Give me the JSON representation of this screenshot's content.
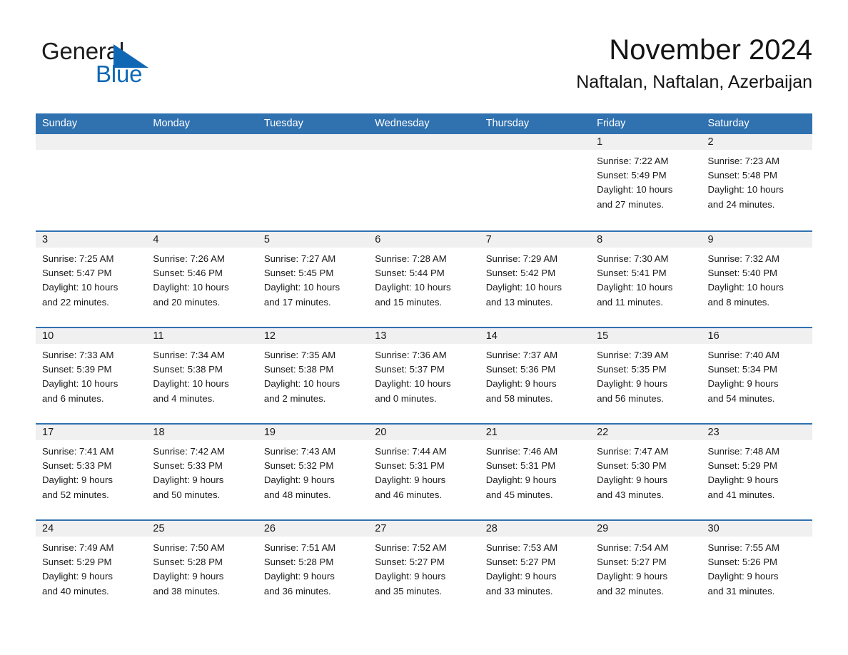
{
  "brand": {
    "word1": "General",
    "word2": "Blue",
    "triangle_color": "#1068b5"
  },
  "header": {
    "title": "November 2024",
    "subtitle": "Naftalan, Naftalan, Azerbaijan"
  },
  "colors": {
    "header_blue": "#3071b0",
    "day_head_grey": "#f0f0f0",
    "text": "#1a1a1a",
    "brand_blue": "#1068b5"
  },
  "weekday_headers": [
    "Sunday",
    "Monday",
    "Tuesday",
    "Wednesday",
    "Thursday",
    "Friday",
    "Saturday"
  ],
  "labels": {
    "sunrise_prefix": "Sunrise: ",
    "sunset_prefix": "Sunset: ",
    "daylight_prefix": "Daylight: "
  },
  "weeks": [
    [
      {
        "day": "",
        "empty": true
      },
      {
        "day": "",
        "empty": true
      },
      {
        "day": "",
        "empty": true
      },
      {
        "day": "",
        "empty": true
      },
      {
        "day": "",
        "empty": true
      },
      {
        "day": "1",
        "sunrise": "Sunrise: 7:22 AM",
        "sunset": "Sunset: 5:49 PM",
        "daylight1": "Daylight: 10 hours",
        "daylight2": "and 27 minutes."
      },
      {
        "day": "2",
        "sunrise": "Sunrise: 7:23 AM",
        "sunset": "Sunset: 5:48 PM",
        "daylight1": "Daylight: 10 hours",
        "daylight2": "and 24 minutes."
      }
    ],
    [
      {
        "day": "3",
        "sunrise": "Sunrise: 7:25 AM",
        "sunset": "Sunset: 5:47 PM",
        "daylight1": "Daylight: 10 hours",
        "daylight2": "and 22 minutes."
      },
      {
        "day": "4",
        "sunrise": "Sunrise: 7:26 AM",
        "sunset": "Sunset: 5:46 PM",
        "daylight1": "Daylight: 10 hours",
        "daylight2": "and 20 minutes."
      },
      {
        "day": "5",
        "sunrise": "Sunrise: 7:27 AM",
        "sunset": "Sunset: 5:45 PM",
        "daylight1": "Daylight: 10 hours",
        "daylight2": "and 17 minutes."
      },
      {
        "day": "6",
        "sunrise": "Sunrise: 7:28 AM",
        "sunset": "Sunset: 5:44 PM",
        "daylight1": "Daylight: 10 hours",
        "daylight2": "and 15 minutes."
      },
      {
        "day": "7",
        "sunrise": "Sunrise: 7:29 AM",
        "sunset": "Sunset: 5:42 PM",
        "daylight1": "Daylight: 10 hours",
        "daylight2": "and 13 minutes."
      },
      {
        "day": "8",
        "sunrise": "Sunrise: 7:30 AM",
        "sunset": "Sunset: 5:41 PM",
        "daylight1": "Daylight: 10 hours",
        "daylight2": "and 11 minutes."
      },
      {
        "day": "9",
        "sunrise": "Sunrise: 7:32 AM",
        "sunset": "Sunset: 5:40 PM",
        "daylight1": "Daylight: 10 hours",
        "daylight2": "and 8 minutes."
      }
    ],
    [
      {
        "day": "10",
        "sunrise": "Sunrise: 7:33 AM",
        "sunset": "Sunset: 5:39 PM",
        "daylight1": "Daylight: 10 hours",
        "daylight2": "and 6 minutes."
      },
      {
        "day": "11",
        "sunrise": "Sunrise: 7:34 AM",
        "sunset": "Sunset: 5:38 PM",
        "daylight1": "Daylight: 10 hours",
        "daylight2": "and 4 minutes."
      },
      {
        "day": "12",
        "sunrise": "Sunrise: 7:35 AM",
        "sunset": "Sunset: 5:38 PM",
        "daylight1": "Daylight: 10 hours",
        "daylight2": "and 2 minutes."
      },
      {
        "day": "13",
        "sunrise": "Sunrise: 7:36 AM",
        "sunset": "Sunset: 5:37 PM",
        "daylight1": "Daylight: 10 hours",
        "daylight2": "and 0 minutes."
      },
      {
        "day": "14",
        "sunrise": "Sunrise: 7:37 AM",
        "sunset": "Sunset: 5:36 PM",
        "daylight1": "Daylight: 9 hours",
        "daylight2": "and 58 minutes."
      },
      {
        "day": "15",
        "sunrise": "Sunrise: 7:39 AM",
        "sunset": "Sunset: 5:35 PM",
        "daylight1": "Daylight: 9 hours",
        "daylight2": "and 56 minutes."
      },
      {
        "day": "16",
        "sunrise": "Sunrise: 7:40 AM",
        "sunset": "Sunset: 5:34 PM",
        "daylight1": "Daylight: 9 hours",
        "daylight2": "and 54 minutes."
      }
    ],
    [
      {
        "day": "17",
        "sunrise": "Sunrise: 7:41 AM",
        "sunset": "Sunset: 5:33 PM",
        "daylight1": "Daylight: 9 hours",
        "daylight2": "and 52 minutes."
      },
      {
        "day": "18",
        "sunrise": "Sunrise: 7:42 AM",
        "sunset": "Sunset: 5:33 PM",
        "daylight1": "Daylight: 9 hours",
        "daylight2": "and 50 minutes."
      },
      {
        "day": "19",
        "sunrise": "Sunrise: 7:43 AM",
        "sunset": "Sunset: 5:32 PM",
        "daylight1": "Daylight: 9 hours",
        "daylight2": "and 48 minutes."
      },
      {
        "day": "20",
        "sunrise": "Sunrise: 7:44 AM",
        "sunset": "Sunset: 5:31 PM",
        "daylight1": "Daylight: 9 hours",
        "daylight2": "and 46 minutes."
      },
      {
        "day": "21",
        "sunrise": "Sunrise: 7:46 AM",
        "sunset": "Sunset: 5:31 PM",
        "daylight1": "Daylight: 9 hours",
        "daylight2": "and 45 minutes."
      },
      {
        "day": "22",
        "sunrise": "Sunrise: 7:47 AM",
        "sunset": "Sunset: 5:30 PM",
        "daylight1": "Daylight: 9 hours",
        "daylight2": "and 43 minutes."
      },
      {
        "day": "23",
        "sunrise": "Sunrise: 7:48 AM",
        "sunset": "Sunset: 5:29 PM",
        "daylight1": "Daylight: 9 hours",
        "daylight2": "and 41 minutes."
      }
    ],
    [
      {
        "day": "24",
        "sunrise": "Sunrise: 7:49 AM",
        "sunset": "Sunset: 5:29 PM",
        "daylight1": "Daylight: 9 hours",
        "daylight2": "and 40 minutes."
      },
      {
        "day": "25",
        "sunrise": "Sunrise: 7:50 AM",
        "sunset": "Sunset: 5:28 PM",
        "daylight1": "Daylight: 9 hours",
        "daylight2": "and 38 minutes."
      },
      {
        "day": "26",
        "sunrise": "Sunrise: 7:51 AM",
        "sunset": "Sunset: 5:28 PM",
        "daylight1": "Daylight: 9 hours",
        "daylight2": "and 36 minutes."
      },
      {
        "day": "27",
        "sunrise": "Sunrise: 7:52 AM",
        "sunset": "Sunset: 5:27 PM",
        "daylight1": "Daylight: 9 hours",
        "daylight2": "and 35 minutes."
      },
      {
        "day": "28",
        "sunrise": "Sunrise: 7:53 AM",
        "sunset": "Sunset: 5:27 PM",
        "daylight1": "Daylight: 9 hours",
        "daylight2": "and 33 minutes."
      },
      {
        "day": "29",
        "sunrise": "Sunrise: 7:54 AM",
        "sunset": "Sunset: 5:27 PM",
        "daylight1": "Daylight: 9 hours",
        "daylight2": "and 32 minutes."
      },
      {
        "day": "30",
        "sunrise": "Sunrise: 7:55 AM",
        "sunset": "Sunset: 5:26 PM",
        "daylight1": "Daylight: 9 hours",
        "daylight2": "and 31 minutes."
      }
    ]
  ]
}
